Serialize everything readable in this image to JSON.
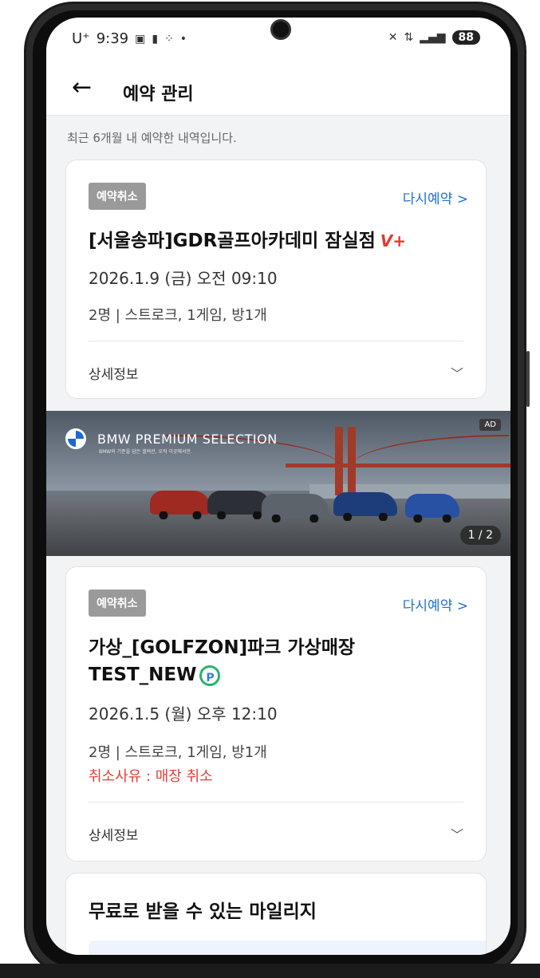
{
  "status_bar": {
    "carrier": "U⁺",
    "time": "9:39",
    "battery": "88"
  },
  "header": {
    "title": "예약 관리"
  },
  "subtitle": "최근 6개월 내 예약한 내역입니다.",
  "reservations": [
    {
      "status": "예약취소",
      "rebook_label": "다시예약 >",
      "store": "[서울송파]GDR골프아카데미 잠실점",
      "store_badge": "V+",
      "datetime": "2026.1.9 (금) 오전 09:10",
      "info": "2명 | 스트로크, 1게임, 방1개",
      "detail_label": "상세정보"
    },
    {
      "status": "예약취소",
      "rebook_label": "다시예약 >",
      "store": "가상_[GOLFZON]파크 가상매장 TEST_NEW",
      "store_badge": "P",
      "datetime": "2026.1.5 (월) 오후 12:10",
      "info": "2명 | 스트로크, 1게임, 방1개",
      "cancel_reason": "취소사유 : 매장 취소",
      "detail_label": "상세정보"
    }
  ],
  "ad": {
    "brand": "BMW PREMIUM SELECTION",
    "tagline": "BMW의 기준을 담은 셀렉션, 오직 이곳에서만.",
    "tag": "AD",
    "counter": "1 / 2"
  },
  "mileage": {
    "title": "무료로 받을 수 있는 마일리지"
  }
}
